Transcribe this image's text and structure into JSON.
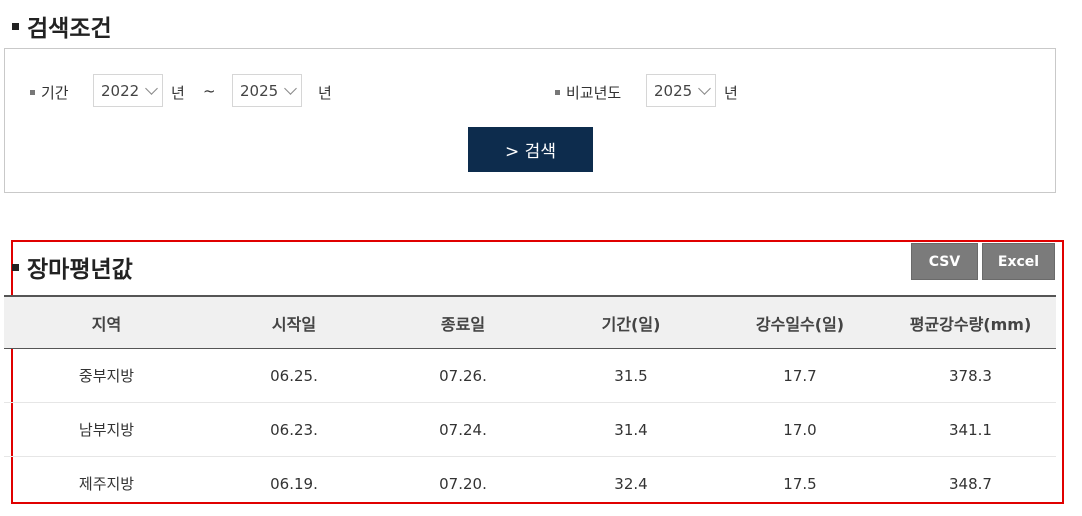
{
  "search_section": {
    "title": "검색조건",
    "period_label": "기간",
    "start_year": "2022",
    "year_unit": "년",
    "tilde": "~",
    "end_year": "2025",
    "compare_label": "비교년도",
    "compare_year": "2025",
    "search_button": "> 검색"
  },
  "result_section": {
    "title": "장마평년값",
    "csv_button": "CSV",
    "excel_button": "Excel",
    "columns": [
      "지역",
      "시작일",
      "종료일",
      "기간(일)",
      "강수일수(일)",
      "평균강수량(mm)"
    ],
    "rows": [
      [
        "중부지방",
        "06.25.",
        "07.26.",
        "31.5",
        "17.7",
        "378.3"
      ],
      [
        "남부지방",
        "06.23.",
        "07.24.",
        "31.4",
        "17.0",
        "341.1"
      ],
      [
        "제주지방",
        "06.19.",
        "07.20.",
        "32.4",
        "17.5",
        "348.7"
      ]
    ]
  },
  "colors": {
    "search_button_bg": "#0d2c4d",
    "tool_button_bg": "#7b7b7b",
    "highlight_border": "#e00000"
  }
}
